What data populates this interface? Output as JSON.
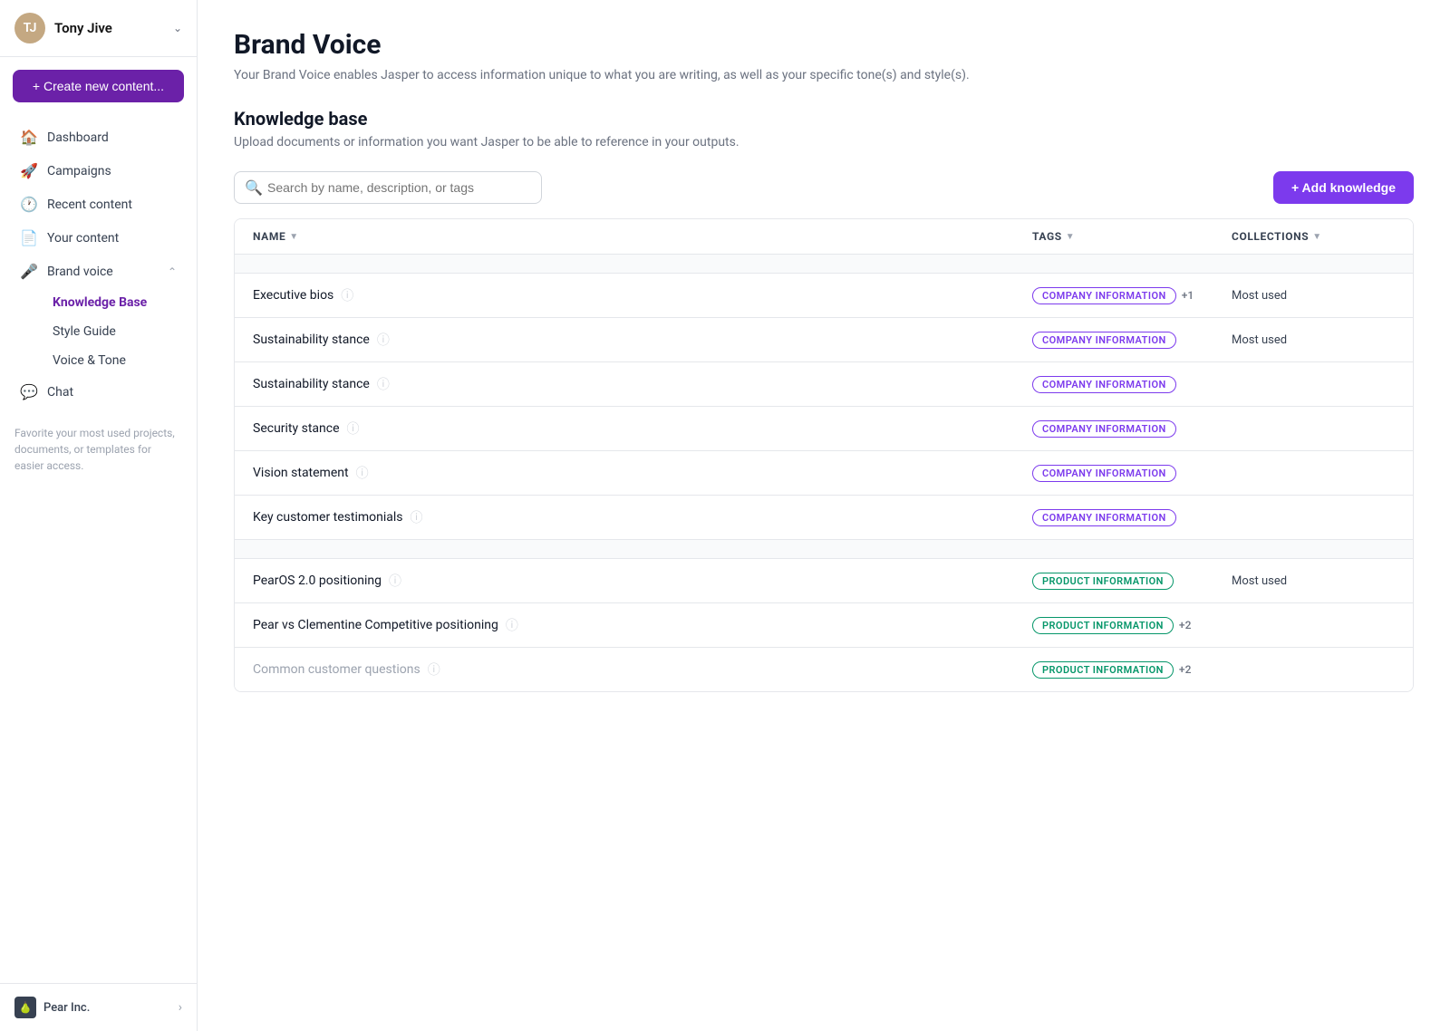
{
  "sidebar": {
    "username": "Tony Jive",
    "create_label": "+ Create new content...",
    "nav_items": [
      {
        "id": "dashboard",
        "label": "Dashboard",
        "icon": "🏠"
      },
      {
        "id": "campaigns",
        "label": "Campaigns",
        "icon": "🚀"
      },
      {
        "id": "recent-content",
        "label": "Recent content",
        "icon": "🕐"
      },
      {
        "id": "your-content",
        "label": "Your content",
        "icon": "📄"
      },
      {
        "id": "brand-voice",
        "label": "Brand voice",
        "icon": "🎤"
      }
    ],
    "brand_voice_sub": [
      {
        "id": "knowledge-base",
        "label": "Knowledge Base"
      },
      {
        "id": "style-guide",
        "label": "Style Guide"
      },
      {
        "id": "voice-tone",
        "label": "Voice & Tone"
      }
    ],
    "chat": {
      "label": "Chat",
      "icon": "💬"
    },
    "hint": "Favorite your most used projects, documents, or templates for easier access.",
    "footer": {
      "company": "Pear Inc.",
      "chevron": "›"
    }
  },
  "main": {
    "page_title": "Brand Voice",
    "page_subtitle": "Your Brand Voice enables Jasper to access information unique to what you are writing, as well as your specific tone(s) and style(s).",
    "section_title": "Knowledge base",
    "section_subtitle": "Upload documents or information you want Jasper to be able to reference in your outputs.",
    "search_placeholder": "Search by name, description, or tags",
    "add_button": "+ Add knowledge",
    "table": {
      "columns": [
        "NAME",
        "TAGS",
        "COLLECTIONS"
      ],
      "groups": [
        {
          "id": "company-group",
          "rows": [
            {
              "name": "Executive bios",
              "tag": "COMPANY INFORMATION",
              "tag_type": "company",
              "extra_count": "+1",
              "collection": "Most used"
            },
            {
              "name": "Sustainability stance",
              "tag": "COMPANY INFORMATION",
              "tag_type": "company",
              "extra_count": "",
              "collection": "Most used"
            },
            {
              "name": "Sustainability stance",
              "tag": "COMPANY INFORMATION",
              "tag_type": "company",
              "extra_count": "",
              "collection": ""
            },
            {
              "name": "Security stance",
              "tag": "COMPANY INFORMATION",
              "tag_type": "company",
              "extra_count": "",
              "collection": ""
            },
            {
              "name": "Vision statement",
              "tag": "COMPANY INFORMATION",
              "tag_type": "company",
              "extra_count": "",
              "collection": ""
            },
            {
              "name": "Key customer testimonials",
              "tag": "COMPANY INFORMATION",
              "tag_type": "company",
              "extra_count": "",
              "collection": ""
            }
          ]
        },
        {
          "id": "product-group",
          "rows": [
            {
              "name": "PearOS 2.0 positioning",
              "tag": "PRODUCT INFORMATION",
              "tag_type": "product",
              "extra_count": "",
              "collection": "Most used"
            },
            {
              "name": "Pear vs Clementine Competitive positioning",
              "tag": "PRODUCT INFORMATION",
              "tag_type": "product",
              "extra_count": "+2",
              "collection": ""
            },
            {
              "name": "Common customer questions",
              "tag": "PRODUCT INFORMATION",
              "tag_type": "product",
              "extra_count": "+2",
              "collection": "",
              "muted": true
            }
          ]
        }
      ]
    }
  }
}
